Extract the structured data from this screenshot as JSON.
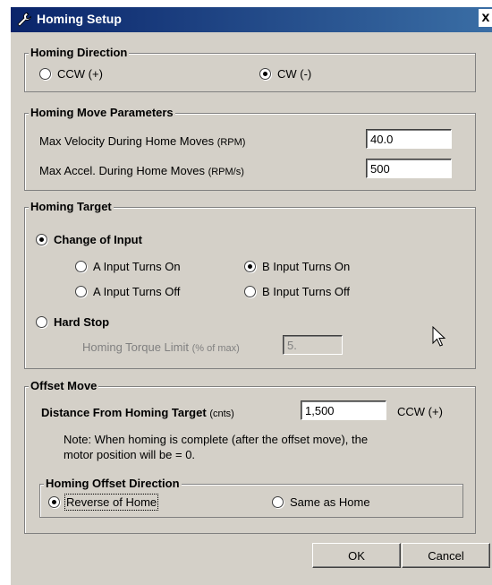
{
  "window": {
    "title": "Homing Setup",
    "close_glyph": "x",
    "icon": "wrench-icon"
  },
  "homing_direction": {
    "legend": "Homing Direction",
    "options": [
      {
        "label": "CCW (+)",
        "selected": false
      },
      {
        "label": "CW (-)",
        "selected": true
      }
    ]
  },
  "move_params": {
    "legend": "Homing Move Parameters",
    "velocity_label": "Max Velocity During Home Moves",
    "velocity_unit": "(RPM)",
    "velocity_value": "40.0",
    "accel_label": "Max Accel. During Home Moves",
    "accel_unit": "(RPM/s)",
    "accel_value": "500"
  },
  "homing_target": {
    "legend": "Homing Target",
    "change_of_input": {
      "label": "Change of Input",
      "selected": true
    },
    "inputs": [
      {
        "label": "A Input Turns On",
        "selected": false
      },
      {
        "label": "B Input Turns On",
        "selected": true
      },
      {
        "label": "A Input Turns Off",
        "selected": false
      },
      {
        "label": "B Input Turns Off",
        "selected": false
      }
    ],
    "hard_stop": {
      "label": "Hard Stop",
      "selected": false
    },
    "torque_label": "Homing Torque Limit",
    "torque_unit": "(% of max)",
    "torque_value": "5."
  },
  "offset_move": {
    "legend": "Offset Move",
    "distance_label": "Distance From Homing Target",
    "distance_unit": "(cnts)",
    "distance_value": "1,500",
    "distance_direction": "CCW (+)",
    "note_line1": "Note: When homing is complete (after the offset move), the",
    "note_line2": "motor position will be = 0.",
    "direction_legend": "Homing Offset Direction",
    "direction_options": [
      {
        "label": "Reverse of Home",
        "selected": true
      },
      {
        "label": "Same as Home",
        "selected": false
      }
    ]
  },
  "buttons": {
    "ok": "OK",
    "cancel": "Cancel"
  }
}
